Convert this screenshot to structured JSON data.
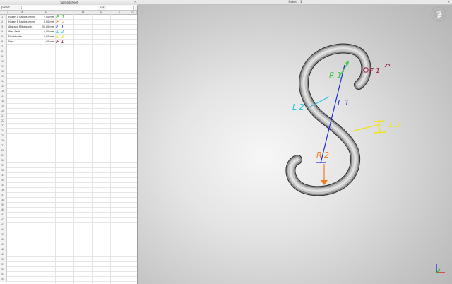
{
  "spreadsheet": {
    "title": "Spreadsheet",
    "close_glyph": "✕",
    "input_label": "pread",
    "alias_label": "lias:",
    "column_headers": [
      "A",
      "B",
      "C",
      "D",
      "E",
      "F",
      "G"
    ],
    "rows": [
      {
        "n": "1",
        "a": "Haken A Radius innen",
        "b": "7,00 mm",
        "c": "R 1",
        "color": "#35c93a"
      },
      {
        "n": "2",
        "a": "Haken B Radius innen",
        "b": "6,00 mm",
        "c": "R 2",
        "color": "#f47a1f"
      },
      {
        "n": "3",
        "a": "Abstand Mittelpunkt",
        "b": "30,00 mm",
        "c": "L 1",
        "color": "#1b2bd6"
      },
      {
        "n": "4",
        "a": "Weg Seite",
        "b": "5,00 mm",
        "c": "L 2",
        "color": "#23c4e0"
      },
      {
        "n": "5",
        "a": "Flachbreite",
        "b": "6,00 mm",
        "c": "L 3",
        "color": "#f2e21c"
      },
      {
        "n": "6",
        "a": "Fase",
        "b": "1,00 mm",
        "c": "F 1",
        "color": "#9c1c3c"
      }
    ],
    "empty_row_numbers": [
      "7",
      "8",
      "9",
      "10",
      "11",
      "12",
      "13",
      "14",
      "15",
      "16",
      "17",
      "18",
      "19",
      "20",
      "21",
      "22",
      "23",
      "24",
      "25",
      "26",
      "27",
      "28",
      "29",
      "30",
      "31",
      "32",
      "33",
      "34",
      "35",
      "36",
      "37",
      "38",
      "39",
      "40",
      "41",
      "42",
      "43",
      "44",
      "45",
      "46",
      "47",
      "48",
      "49",
      "50",
      "51",
      "52",
      "53",
      "54"
    ]
  },
  "viewport": {
    "title": "Haken : 1",
    "close_glyph": "✕",
    "navcube_label": "FRONT",
    "annotations": [
      {
        "key": "r1",
        "text": "R 1",
        "color": "#35c93a"
      },
      {
        "key": "r2",
        "text": "R 2",
        "color": "#f47a1f"
      },
      {
        "key": "l1",
        "text": "L 1",
        "color": "#1b2bd6"
      },
      {
        "key": "l2",
        "text": "L 2",
        "color": "#23c4e0"
      },
      {
        "key": "l3",
        "text": "L 3",
        "color": "#f2e21c"
      },
      {
        "key": "f1",
        "text": "F 1",
        "color": "#9c1c3c"
      }
    ],
    "axes": {
      "x_color": "#e02020",
      "y_color": "#20b020",
      "z_color": "#2030e0"
    }
  }
}
